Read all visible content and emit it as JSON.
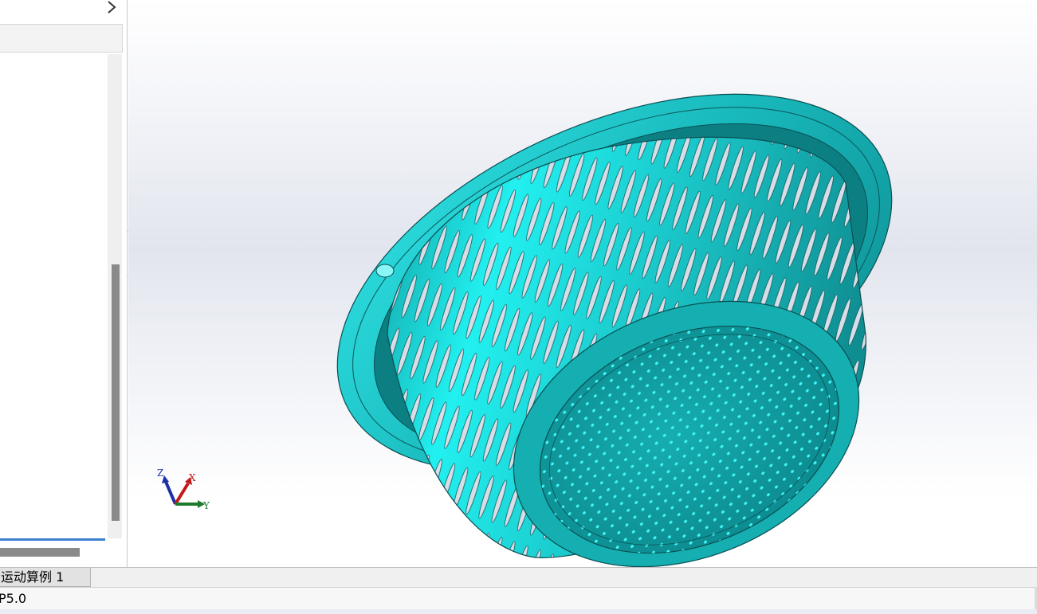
{
  "feature_panel": {
    "expand_icon": "chevron-right-icon",
    "field_value": ""
  },
  "viewport": {
    "model_color": "#1fc7c9",
    "triad": {
      "z_label": "Z",
      "x_label": "X",
      "y_label": "Y"
    }
  },
  "bottom_tabs": [
    {
      "label": "运动算例 1"
    }
  ],
  "status": {
    "text": "P5.0"
  }
}
